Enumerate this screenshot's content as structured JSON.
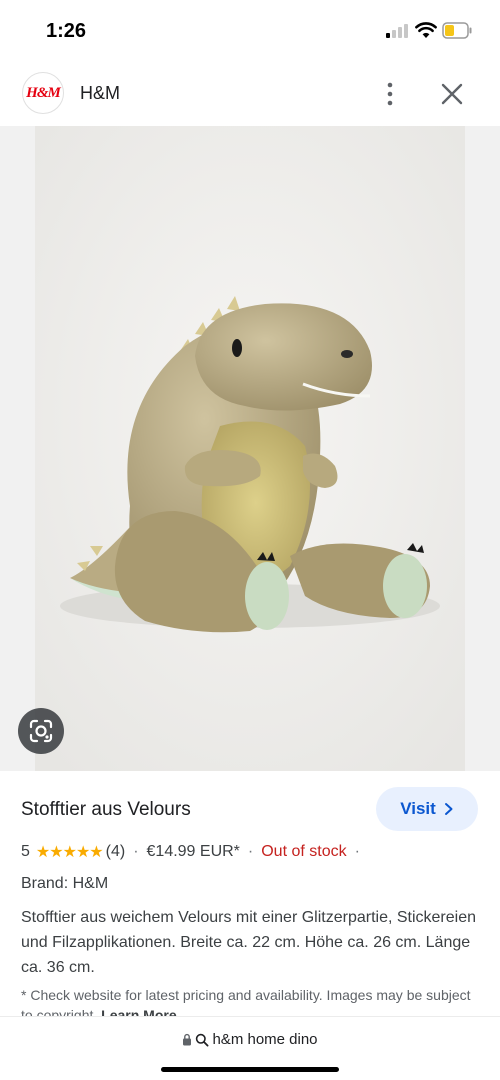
{
  "status_bar": {
    "time": "1:26"
  },
  "header": {
    "logo_text": "H&M",
    "site_name": "H&M"
  },
  "product": {
    "title": "Stofftier aus Velours",
    "visit_label": "Visit",
    "rating_value": "5",
    "stars": "★★★★★",
    "review_count": "(4)",
    "price": "€14.99 EUR*",
    "stock_status": "Out of stock",
    "brand": "Brand: H&M",
    "description": "Stofftier aus weichem Velours mit einer Glitzerpartie, Stickereien und Filzapplikationen. Breite ca. 22 cm. Höhe ca. 26 cm. Länge ca. 36 cm.",
    "disclaimer": "* Check website for latest pricing and availability. Images may be subject to copyright.",
    "learn_more": "Learn More"
  },
  "bottom_bar": {
    "url_text": "h&m home dino"
  },
  "colors": {
    "accent": "#0b57d0",
    "visit_bg": "#e8f0fe",
    "out_of_stock": "#c5221f",
    "star": "#f9ab00",
    "brand_red": "#e50010"
  },
  "icons": [
    "signal-icon",
    "wifi-icon",
    "battery-icon",
    "more-vert-icon",
    "close-icon",
    "lens-icon",
    "chevron-right-icon",
    "lock-icon",
    "search-icon"
  ]
}
